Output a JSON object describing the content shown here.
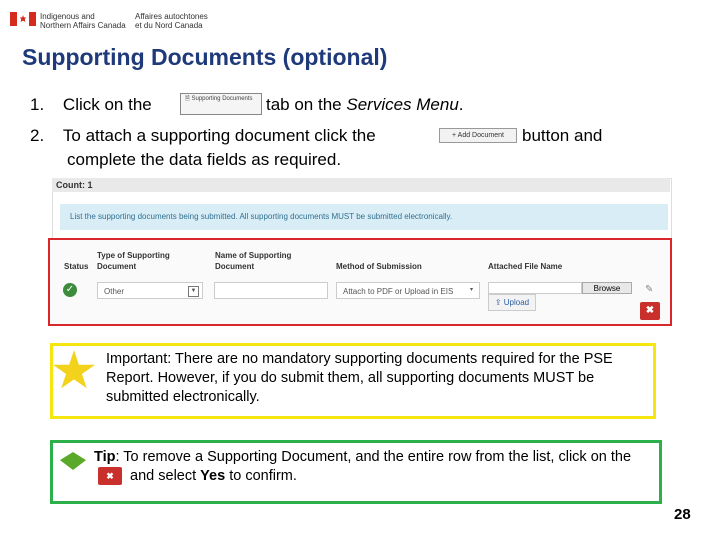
{
  "header": {
    "dept_en_line1": "Indigenous and",
    "dept_en_line2": "Northern Affairs Canada",
    "dept_fr_line1": "Affaires autochtones",
    "dept_fr_line2": "et du Nord Canada"
  },
  "title": "Supporting Documents (optional)",
  "steps": {
    "s1_num": "1.",
    "s1_pre": "Click on the",
    "s1_tab_label": "Supporting Documents",
    "s1_post": "tab on the",
    "s1_menu": "Services Menu",
    "s1_end": ".",
    "s2_num": "2.",
    "s2_pre": "To attach a supporting document click the",
    "s2_button_label": "+ Add Document",
    "s2_post": "button and",
    "s2_line2": "complete the data fields as required."
  },
  "panel": {
    "count_label": "Count: 1",
    "info_text": "List the supporting documents being submitted. All supporting documents MUST be submitted electronically.",
    "columns": {
      "status": "Status",
      "type": "Type of Supporting Document",
      "name": "Name of Supporting Document",
      "method": "Method of Submission",
      "file": "Attached File Name"
    },
    "row": {
      "type_value": "Other",
      "method_value": "Attach to PDF or Upload in EIS",
      "browse_label": "Browse",
      "upload_label": "Upload",
      "delete_label": "✖"
    }
  },
  "important": {
    "label": "Important",
    "text": ": There are no mandatory supporting documents required for the PSE Report. However, if you do submit them, all supporting documents MUST be submitted electronically."
  },
  "tip": {
    "label": "Tip",
    "text1": ": To remove a Supporting Document, and the entire row from the list, click on the",
    "text2": "and select",
    "yes": "Yes",
    "text3": "to confirm.",
    "delete_label": "✖"
  },
  "page_number": "28"
}
